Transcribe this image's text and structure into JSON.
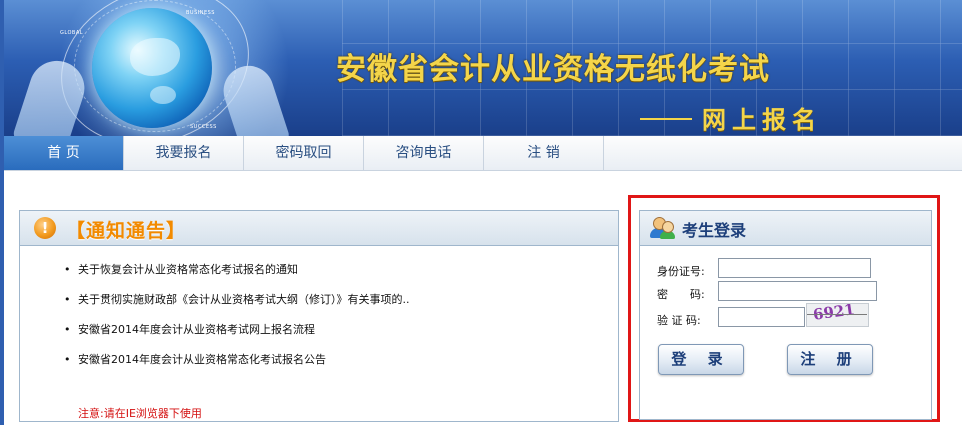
{
  "header": {
    "title": "安徽省会计从业资格无纸化考试",
    "subtitle": "网上报名",
    "globe_tags": [
      "GLOBAL",
      "BUSINESS",
      "SUCCESS"
    ]
  },
  "nav": {
    "items": [
      {
        "label": "首 页",
        "active": true
      },
      {
        "label": "我要报名",
        "active": false
      },
      {
        "label": "密码取回",
        "active": false
      },
      {
        "label": "咨询电话",
        "active": false
      },
      {
        "label": "注 销",
        "active": false
      }
    ]
  },
  "notice": {
    "title": "【通知通告】",
    "items": [
      "关于恢复会计从业资格常态化考试报名的通知",
      "关于贯彻实施财政部《会计从业资格考试大纲（修订）》有关事项的..",
      "安徽省2014年度会计从业资格考试网上报名流程",
      "安徽省2014年度会计从业资格常态化考试报名公告"
    ],
    "warning": "注意:请在IE浏览器下使用"
  },
  "login": {
    "title": "考生登录",
    "id_label": "身份证号:",
    "id_value": "",
    "password_label": "密　　码:",
    "password_value": "",
    "captcha_label": "验 证 码:",
    "captcha_value": "",
    "captcha_text": "6921",
    "login_button": "登 录",
    "register_button": "注 册"
  },
  "colors": {
    "accent": "#2a6cbd",
    "title_gold": "#f4d54a",
    "notice_orange": "#f28a00",
    "warning_red": "#d41010",
    "highlight_box": "#e01616"
  }
}
